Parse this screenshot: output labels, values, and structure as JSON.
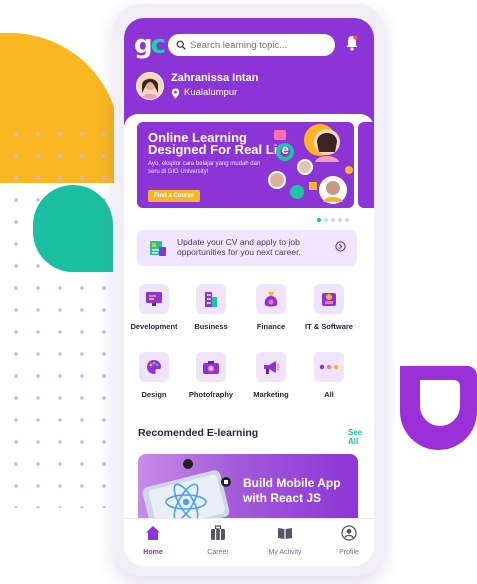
{
  "app": {
    "logo_text": "gc"
  },
  "search": {
    "placeholder": "Search learning topic..."
  },
  "user": {
    "name": "Zahranissa Intan",
    "location": "Kualalumpur"
  },
  "banner": {
    "title": "Online Learning Designed For Real Life",
    "subtitle": "Ayo, eksplor cara belajar yang mudah dan seru di GIG University!",
    "button_label": "Find a Course",
    "pages_total": 5,
    "active_page": 1
  },
  "cv_card": {
    "text": "Update your CV and  apply to job opportunities for you next career."
  },
  "categories": [
    {
      "label": "Development",
      "icon": "monitor-icon"
    },
    {
      "label": "Business",
      "icon": "building-icon"
    },
    {
      "label": "Finance",
      "icon": "money-bag-icon"
    },
    {
      "label": "IT & Software",
      "icon": "software-icon"
    },
    {
      "label": "Design",
      "icon": "palette-icon"
    },
    {
      "label": "Photofraphy",
      "icon": "camera-icon"
    },
    {
      "label": "Marketing",
      "icon": "megaphone-icon"
    },
    {
      "label": "All",
      "icon": "more-dots-icon"
    }
  ],
  "recommended": {
    "title": "Recomended E-learning",
    "see_all": "See All",
    "course_title": "Build Mobile App with React JS"
  },
  "nav": [
    {
      "label": "Home",
      "icon": "home-icon",
      "active": true
    },
    {
      "label": "Career",
      "icon": "briefcase-icon",
      "active": false
    },
    {
      "label": "My Activity",
      "icon": "book-icon",
      "active": false
    },
    {
      "label": "Profile",
      "icon": "profile-icon",
      "active": false
    }
  ],
  "colors": {
    "primary": "#8b35d6",
    "accent": "#1cc4a2",
    "yellow": "#f7b525"
  }
}
